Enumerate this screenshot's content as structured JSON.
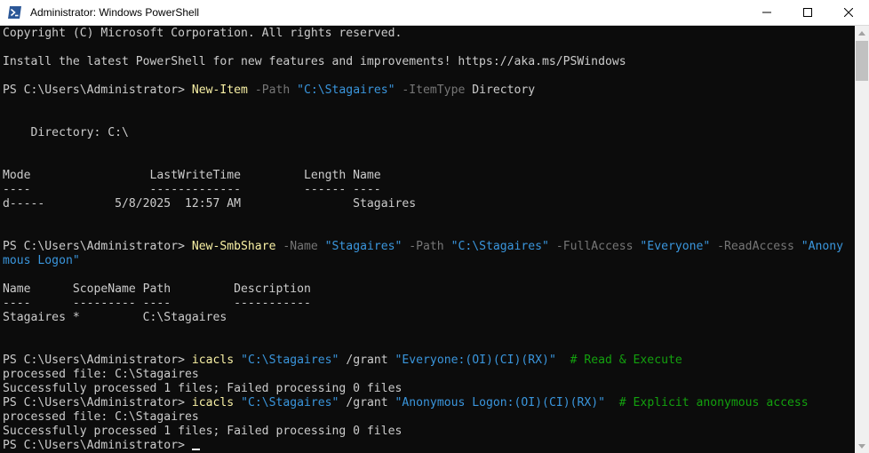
{
  "window": {
    "title": "Administrator: Windows PowerShell",
    "icon": "powershell-icon",
    "controls": [
      "minimize-icon",
      "maximize-icon",
      "close-icon"
    ]
  },
  "colors": {
    "background": "#0c0c0c",
    "foreground": "#cccccc",
    "command": "#f9f1a5",
    "parameter": "#767676",
    "string": "#3a96dd",
    "comment": "#13a10e"
  },
  "console": {
    "lines": [
      {
        "row": 0,
        "segs": [
          {
            "t": "Copyright (C) Microsoft Corporation. All rights reserved."
          }
        ]
      },
      {
        "row": 2,
        "segs": [
          {
            "t": "Install the latest PowerShell for new features and improvements! https://aka.ms/PSWindows"
          }
        ]
      },
      {
        "row": 4,
        "segs": [
          {
            "t": "PS C:\\Users\\Administrator> "
          },
          {
            "t": "New-Item",
            "c": "cmd"
          },
          {
            "t": " -Path ",
            "c": "param"
          },
          {
            "t": "\"C:\\Stagaires\"",
            "c": "str"
          },
          {
            "t": " -ItemType",
            "c": "param"
          },
          {
            "t": " Directory"
          }
        ]
      },
      {
        "row": 7,
        "segs": [
          {
            "t": "    Directory: C:\\"
          }
        ]
      },
      {
        "row": 10,
        "segs": [
          {
            "t": "Mode                 LastWriteTime         Length Name"
          }
        ]
      },
      {
        "row": 11,
        "segs": [
          {
            "t": "----                 -------------         ------ ----"
          }
        ]
      },
      {
        "row": 12,
        "segs": [
          {
            "t": "d-----          5/8/2025  12:57 AM                Stagaires"
          }
        ]
      },
      {
        "row": 15,
        "segs": [
          {
            "t": "PS C:\\Users\\Administrator> "
          },
          {
            "t": "New-SmbShare",
            "c": "cmd"
          },
          {
            "t": " -Name ",
            "c": "param"
          },
          {
            "t": "\"Stagaires\"",
            "c": "str"
          },
          {
            "t": " -Path ",
            "c": "param"
          },
          {
            "t": "\"C:\\Stagaires\"",
            "c": "str"
          },
          {
            "t": " -FullAccess ",
            "c": "param"
          },
          {
            "t": "\"Everyone\"",
            "c": "str"
          },
          {
            "t": " -ReadAccess ",
            "c": "param"
          },
          {
            "t": "\"Anony",
            "c": "str"
          }
        ]
      },
      {
        "row": 16,
        "segs": [
          {
            "t": "mous Logon\"",
            "c": "str"
          }
        ]
      },
      {
        "row": 18,
        "segs": [
          {
            "t": "Name      ScopeName Path         Description"
          }
        ]
      },
      {
        "row": 19,
        "segs": [
          {
            "t": "----      --------- ----         -----------"
          }
        ]
      },
      {
        "row": 20,
        "segs": [
          {
            "t": "Stagaires *         C:\\Stagaires"
          }
        ]
      },
      {
        "row": 23,
        "segs": [
          {
            "t": "PS C:\\Users\\Administrator> "
          },
          {
            "t": "icacls",
            "c": "cmd"
          },
          {
            "t": " "
          },
          {
            "t": "\"C:\\Stagaires\"",
            "c": "str"
          },
          {
            "t": " /grant "
          },
          {
            "t": "\"Everyone:(OI)(CI)(RX)\"",
            "c": "str"
          },
          {
            "t": "  # Read & Execute",
            "c": "cmt"
          }
        ]
      },
      {
        "row": 24,
        "segs": [
          {
            "t": "processed file: C:\\Stagaires"
          }
        ]
      },
      {
        "row": 25,
        "segs": [
          {
            "t": "Successfully processed 1 files; Failed processing 0 files"
          }
        ]
      },
      {
        "row": 26,
        "segs": [
          {
            "t": "PS C:\\Users\\Administrator> "
          },
          {
            "t": "icacls",
            "c": "cmd"
          },
          {
            "t": " "
          },
          {
            "t": "\"C:\\Stagaires\"",
            "c": "str"
          },
          {
            "t": " /grant "
          },
          {
            "t": "\"Anonymous Logon:(OI)(CI)(RX)\"",
            "c": "str"
          },
          {
            "t": "  # Explicit anonymous access",
            "c": "cmt"
          }
        ]
      },
      {
        "row": 27,
        "segs": [
          {
            "t": "processed file: C:\\Stagaires"
          }
        ]
      },
      {
        "row": 28,
        "segs": [
          {
            "t": "Successfully processed 1 files; Failed processing 0 files"
          }
        ]
      },
      {
        "row": 29,
        "segs": [
          {
            "t": "PS C:\\Users\\Administrator> "
          }
        ],
        "cursor": true
      }
    ]
  },
  "scrollbar": {
    "up_icon": "scroll-up-icon",
    "down_icon": "scroll-down-icon"
  }
}
